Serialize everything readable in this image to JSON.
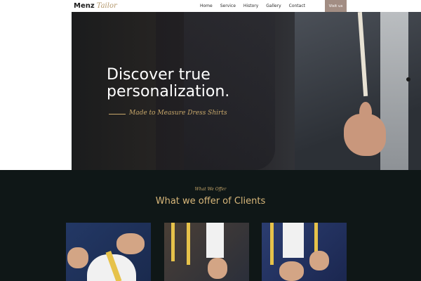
{
  "nav": {
    "logo_main": "Menz",
    "logo_script": "Tailor",
    "links": [
      "Home",
      "Service",
      "History",
      "Gallery",
      "Contact"
    ],
    "cta": "Visit us"
  },
  "hero": {
    "title": "Discover true personalization.",
    "subtitle": "Made to Measure Dress Shirts"
  },
  "offer": {
    "eyebrow": "What We Offer",
    "title": "What we offer of Clients"
  },
  "colors": {
    "accent": "#c8a86b",
    "nav_button": "#a28d83",
    "section_bg": "#0f1717"
  }
}
